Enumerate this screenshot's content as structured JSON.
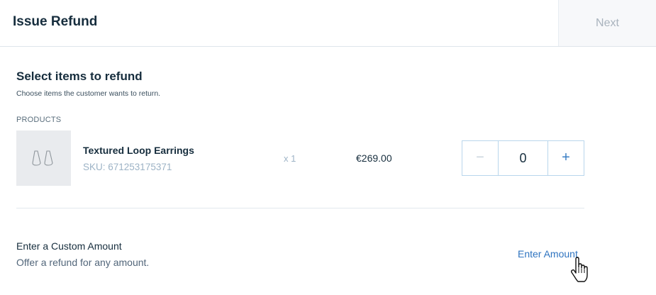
{
  "header": {
    "title": "Issue Refund",
    "next_label": "Next"
  },
  "select_items": {
    "title": "Select items to refund",
    "subtitle": "Choose items the customer wants to return.",
    "products_label": "PRODUCTS"
  },
  "products": [
    {
      "name": "Textured Loop Earrings",
      "sku": "SKU: 671253175371",
      "quantity": "x 1",
      "price": "€269.00",
      "refund_count": "0",
      "thumbnail_icon": "earrings-icon"
    }
  ],
  "stepper": {
    "minus_symbol": "−",
    "plus_symbol": "+"
  },
  "custom_amount": {
    "title": "Enter a Custom Amount",
    "subtitle": "Offer a refund for any amount.",
    "link_label": "Enter Amount"
  },
  "colors": {
    "accent": "#2f74c0",
    "text_primary": "#162d3d",
    "text_muted": "#9db3c6",
    "stepper_border": "#b9d6ec"
  }
}
